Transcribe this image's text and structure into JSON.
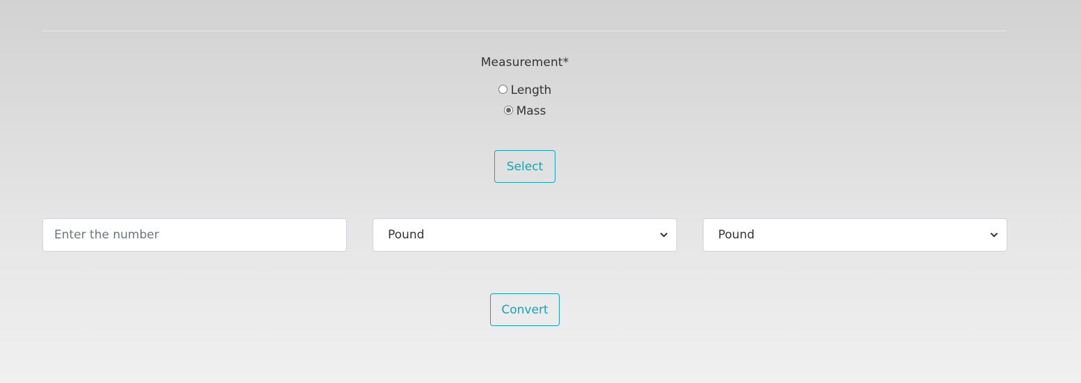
{
  "form": {
    "measurement_label": "Measurement*",
    "options": [
      {
        "label": "Length",
        "checked": false
      },
      {
        "label": "Mass",
        "checked": true
      }
    ],
    "select_button": "Select",
    "number_input": {
      "placeholder": "Enter the number",
      "value": ""
    },
    "from_unit": "Pound",
    "to_unit": "Pound",
    "convert_button": "Convert"
  },
  "colors": {
    "accent": "#17a2b8"
  },
  "icons": {
    "dropdown": "chevron-down-icon"
  }
}
